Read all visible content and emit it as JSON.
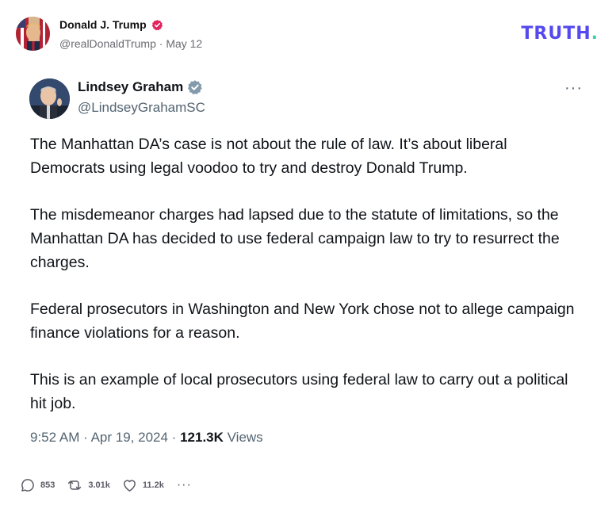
{
  "truth": {
    "author_name": "Donald J. Trump",
    "author_handle": "@realDonaldTrump",
    "separator": "·",
    "date": "May 12",
    "logo_text": "TRUTH",
    "logo_dot": ".",
    "accent_color": "#5448EE",
    "verified_color": "#E0245E"
  },
  "embedded_post": {
    "author_name": "Lindsey Graham",
    "author_handle": "@LindseyGrahamSC",
    "more_label": "···",
    "paragraphs": [
      "The Manhattan DA’s case is not about the rule of law. It’s about liberal Democrats using legal voodoo to try and destroy Donald Trump.",
      "The misdemeanor charges had lapsed due to the statute of limitations, so the Manhattan DA has decided to use federal campaign law to try to resurrect the charges.",
      "Federal prosecutors in Washington and New York chose not to allege campaign finance violations for a reason.",
      "This is an example of local prosecutors using federal law to carry out a political hit job."
    ],
    "time": "9:52 AM",
    "date": "Apr 19, 2024",
    "separator": "·",
    "views_count": "121.3K",
    "views_label": "Views",
    "badge_color": "#829AAB"
  },
  "actions": {
    "replies": "853",
    "retruths": "3.01k",
    "likes": "11.2k",
    "more_label": "···"
  },
  "icons": [
    "verified-icon",
    "gray-verified-icon",
    "reply-icon",
    "retruth-icon",
    "like-icon",
    "more-icon"
  ]
}
